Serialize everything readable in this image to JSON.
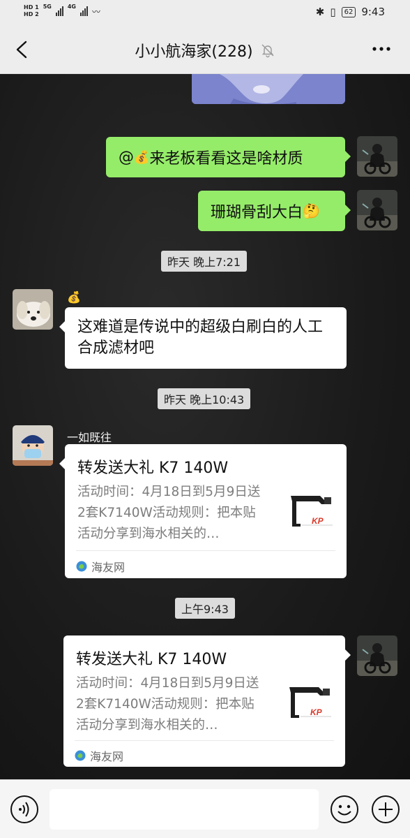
{
  "status_bar": {
    "sim1": "HD 1",
    "sim2": "HD 2",
    "net1": "5G",
    "net2": "4G",
    "time": "9:43",
    "battery": "62"
  },
  "header": {
    "title": "小小航海家(228)"
  },
  "messages": {
    "m1": {
      "text_prefix": "@",
      "emoji": "💰",
      "text": " 来老板看看这是啥材质"
    },
    "m2": {
      "text": "珊瑚骨刮大白",
      "emoji": "🤔"
    },
    "ts1": "昨天 晚上7:21",
    "m3": {
      "sender_emoji": "💰",
      "text": "这难道是传说中的超级白刷白的人工合成滤材吧"
    },
    "ts2": "昨天 晚上10:43",
    "m4": {
      "sender": "一如既往",
      "card_title": "转发送大礼 K7 140W",
      "card_desc": "活动时间：4月18日到5月9日送2套K7140W活动规则：把本贴活动分享到海水相关的…",
      "source": "海友网"
    },
    "ts3": "上午9:43",
    "m5": {
      "card_title": "转发送大礼 K7 140W",
      "card_desc": "活动时间：4月18日到5月9日送2套K7140W活动规则：把本贴活动分享到海水相关的…",
      "source": "海友网"
    }
  },
  "input": {
    "placeholder": ""
  },
  "colors": {
    "green_bubble": "#95ec69",
    "bar_bg": "#ededed",
    "timestamp_bg": "#dcdcdc"
  },
  "icons": [
    "back-arrow-icon",
    "mute-bell-icon",
    "more-icon",
    "voice-icon",
    "emoji-icon",
    "plus-icon",
    "globe-icon"
  ]
}
